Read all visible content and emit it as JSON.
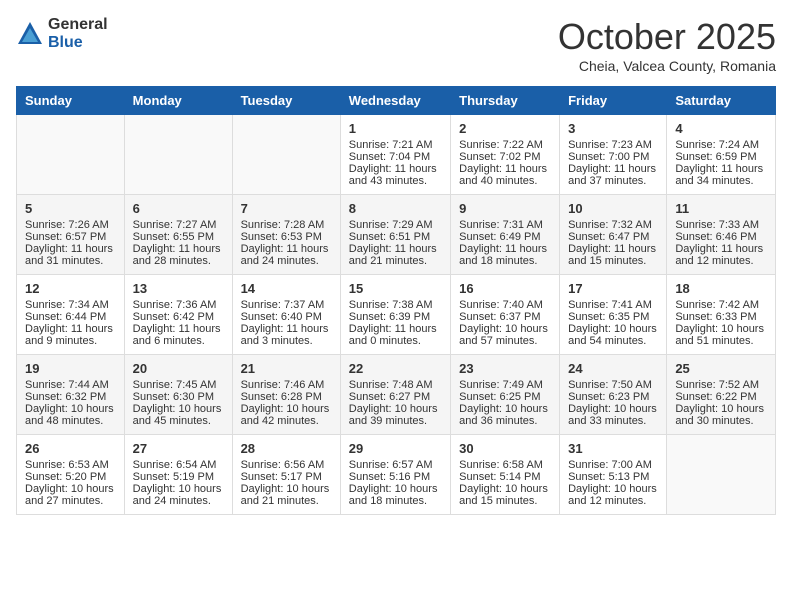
{
  "logo": {
    "general": "General",
    "blue": "Blue"
  },
  "header": {
    "month": "October 2025",
    "location": "Cheia, Valcea County, Romania"
  },
  "weekdays": [
    "Sunday",
    "Monday",
    "Tuesday",
    "Wednesday",
    "Thursday",
    "Friday",
    "Saturday"
  ],
  "weeks": [
    [
      {
        "day": "",
        "sunrise": "",
        "sunset": "",
        "daylight": ""
      },
      {
        "day": "",
        "sunrise": "",
        "sunset": "",
        "daylight": ""
      },
      {
        "day": "",
        "sunrise": "",
        "sunset": "",
        "daylight": ""
      },
      {
        "day": "1",
        "sunrise": "Sunrise: 7:21 AM",
        "sunset": "Sunset: 7:04 PM",
        "daylight": "Daylight: 11 hours and 43 minutes."
      },
      {
        "day": "2",
        "sunrise": "Sunrise: 7:22 AM",
        "sunset": "Sunset: 7:02 PM",
        "daylight": "Daylight: 11 hours and 40 minutes."
      },
      {
        "day": "3",
        "sunrise": "Sunrise: 7:23 AM",
        "sunset": "Sunset: 7:00 PM",
        "daylight": "Daylight: 11 hours and 37 minutes."
      },
      {
        "day": "4",
        "sunrise": "Sunrise: 7:24 AM",
        "sunset": "Sunset: 6:59 PM",
        "daylight": "Daylight: 11 hours and 34 minutes."
      }
    ],
    [
      {
        "day": "5",
        "sunrise": "Sunrise: 7:26 AM",
        "sunset": "Sunset: 6:57 PM",
        "daylight": "Daylight: 11 hours and 31 minutes."
      },
      {
        "day": "6",
        "sunrise": "Sunrise: 7:27 AM",
        "sunset": "Sunset: 6:55 PM",
        "daylight": "Daylight: 11 hours and 28 minutes."
      },
      {
        "day": "7",
        "sunrise": "Sunrise: 7:28 AM",
        "sunset": "Sunset: 6:53 PM",
        "daylight": "Daylight: 11 hours and 24 minutes."
      },
      {
        "day": "8",
        "sunrise": "Sunrise: 7:29 AM",
        "sunset": "Sunset: 6:51 PM",
        "daylight": "Daylight: 11 hours and 21 minutes."
      },
      {
        "day": "9",
        "sunrise": "Sunrise: 7:31 AM",
        "sunset": "Sunset: 6:49 PM",
        "daylight": "Daylight: 11 hours and 18 minutes."
      },
      {
        "day": "10",
        "sunrise": "Sunrise: 7:32 AM",
        "sunset": "Sunset: 6:47 PM",
        "daylight": "Daylight: 11 hours and 15 minutes."
      },
      {
        "day": "11",
        "sunrise": "Sunrise: 7:33 AM",
        "sunset": "Sunset: 6:46 PM",
        "daylight": "Daylight: 11 hours and 12 minutes."
      }
    ],
    [
      {
        "day": "12",
        "sunrise": "Sunrise: 7:34 AM",
        "sunset": "Sunset: 6:44 PM",
        "daylight": "Daylight: 11 hours and 9 minutes."
      },
      {
        "day": "13",
        "sunrise": "Sunrise: 7:36 AM",
        "sunset": "Sunset: 6:42 PM",
        "daylight": "Daylight: 11 hours and 6 minutes."
      },
      {
        "day": "14",
        "sunrise": "Sunrise: 7:37 AM",
        "sunset": "Sunset: 6:40 PM",
        "daylight": "Daylight: 11 hours and 3 minutes."
      },
      {
        "day": "15",
        "sunrise": "Sunrise: 7:38 AM",
        "sunset": "Sunset: 6:39 PM",
        "daylight": "Daylight: 11 hours and 0 minutes."
      },
      {
        "day": "16",
        "sunrise": "Sunrise: 7:40 AM",
        "sunset": "Sunset: 6:37 PM",
        "daylight": "Daylight: 10 hours and 57 minutes."
      },
      {
        "day": "17",
        "sunrise": "Sunrise: 7:41 AM",
        "sunset": "Sunset: 6:35 PM",
        "daylight": "Daylight: 10 hours and 54 minutes."
      },
      {
        "day": "18",
        "sunrise": "Sunrise: 7:42 AM",
        "sunset": "Sunset: 6:33 PM",
        "daylight": "Daylight: 10 hours and 51 minutes."
      }
    ],
    [
      {
        "day": "19",
        "sunrise": "Sunrise: 7:44 AM",
        "sunset": "Sunset: 6:32 PM",
        "daylight": "Daylight: 10 hours and 48 minutes."
      },
      {
        "day": "20",
        "sunrise": "Sunrise: 7:45 AM",
        "sunset": "Sunset: 6:30 PM",
        "daylight": "Daylight: 10 hours and 45 minutes."
      },
      {
        "day": "21",
        "sunrise": "Sunrise: 7:46 AM",
        "sunset": "Sunset: 6:28 PM",
        "daylight": "Daylight: 10 hours and 42 minutes."
      },
      {
        "day": "22",
        "sunrise": "Sunrise: 7:48 AM",
        "sunset": "Sunset: 6:27 PM",
        "daylight": "Daylight: 10 hours and 39 minutes."
      },
      {
        "day": "23",
        "sunrise": "Sunrise: 7:49 AM",
        "sunset": "Sunset: 6:25 PM",
        "daylight": "Daylight: 10 hours and 36 minutes."
      },
      {
        "day": "24",
        "sunrise": "Sunrise: 7:50 AM",
        "sunset": "Sunset: 6:23 PM",
        "daylight": "Daylight: 10 hours and 33 minutes."
      },
      {
        "day": "25",
        "sunrise": "Sunrise: 7:52 AM",
        "sunset": "Sunset: 6:22 PM",
        "daylight": "Daylight: 10 hours and 30 minutes."
      }
    ],
    [
      {
        "day": "26",
        "sunrise": "Sunrise: 6:53 AM",
        "sunset": "Sunset: 5:20 PM",
        "daylight": "Daylight: 10 hours and 27 minutes."
      },
      {
        "day": "27",
        "sunrise": "Sunrise: 6:54 AM",
        "sunset": "Sunset: 5:19 PM",
        "daylight": "Daylight: 10 hours and 24 minutes."
      },
      {
        "day": "28",
        "sunrise": "Sunrise: 6:56 AM",
        "sunset": "Sunset: 5:17 PM",
        "daylight": "Daylight: 10 hours and 21 minutes."
      },
      {
        "day": "29",
        "sunrise": "Sunrise: 6:57 AM",
        "sunset": "Sunset: 5:16 PM",
        "daylight": "Daylight: 10 hours and 18 minutes."
      },
      {
        "day": "30",
        "sunrise": "Sunrise: 6:58 AM",
        "sunset": "Sunset: 5:14 PM",
        "daylight": "Daylight: 10 hours and 15 minutes."
      },
      {
        "day": "31",
        "sunrise": "Sunrise: 7:00 AM",
        "sunset": "Sunset: 5:13 PM",
        "daylight": "Daylight: 10 hours and 12 minutes."
      },
      {
        "day": "",
        "sunrise": "",
        "sunset": "",
        "daylight": ""
      }
    ]
  ]
}
